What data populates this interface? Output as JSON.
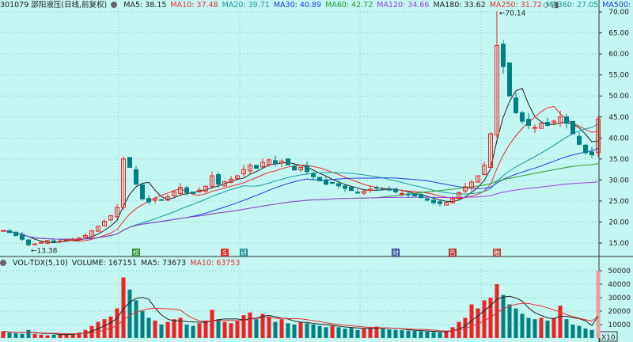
{
  "header": {
    "title": "301079 邵阳液压(日线,前复权)",
    "ma": [
      {
        "label": "MA5: 38.15",
        "color": "#222222"
      },
      {
        "label": "MA10: 37.48",
        "color": "#e53030"
      },
      {
        "label": "MA20: 39.71",
        "color": "#1a9a9a"
      },
      {
        "label": "MA30: 40.89",
        "color": "#2040e0"
      },
      {
        "label": "MA60: 42.72",
        "color": "#2a9a2a"
      },
      {
        "label": "MA120: 34.66",
        "color": "#9a40e0"
      },
      {
        "label": "MA180: 33.62",
        "color": "#222222"
      },
      {
        "label": "MA250: 31.72",
        "color": "#e53030"
      },
      {
        "label": "MA360: 27.05",
        "color": "#1a9a9a"
      },
      {
        "label": "MA500: -",
        "color": "#2040e0"
      }
    ]
  },
  "volume_header": {
    "title": "VOL-TDX(5,10)",
    "volume": "VOLUME: 167151",
    "ma5": "MA5: 73673",
    "ma10": "MA10: 63753"
  },
  "colors": {
    "up": "#ee2222",
    "down": "#008080",
    "bg": "#c4f6f2"
  },
  "chart_data": [
    {
      "type": "candlestick",
      "title": "301079 邵阳液压(日线,前复权)",
      "ylim": [
        13,
        71
      ],
      "yticks": [
        "70.00",
        "65.00",
        "60.00",
        "55.00",
        "50.00",
        "45.00",
        "40.00",
        "35.00",
        "30.00",
        "25.00",
        "20.00",
        "15.00"
      ],
      "grid": true,
      "close": [
        18.0,
        17.5,
        16.8,
        15.9,
        14.6,
        14.8,
        15.2,
        15.6,
        15.3,
        15.5,
        15.8,
        15.9,
        16.2,
        16.8,
        17.9,
        19.0,
        20.2,
        21.5,
        23.5,
        35.0,
        33.0,
        29.0,
        25.5,
        24.8,
        25.6,
        25.2,
        26.0,
        27.2,
        28.3,
        27.0,
        26.8,
        27.6,
        28.5,
        31.0,
        29.0,
        29.6,
        30.2,
        31.0,
        32.5,
        33.5,
        32.8,
        34.2,
        34.8,
        33.9,
        34.5,
        33.6,
        32.4,
        33.0,
        32.0,
        30.8,
        29.8,
        29.0,
        29.4,
        28.6,
        28.0,
        27.5,
        27.0,
        27.4,
        27.8,
        28.2,
        27.9,
        27.6,
        27.2,
        26.8,
        26.5,
        26.2,
        25.8,
        25.2,
        24.6,
        24.4,
        24.7,
        25.5,
        27.0,
        28.4,
        29.5,
        31.0,
        33.5,
        41.0,
        62.0,
        57.0,
        50.0,
        46.0,
        44.0,
        43.0,
        42.5,
        43.5,
        43.0,
        44.0,
        45.0,
        43.5,
        41.0,
        38.5,
        36.5,
        36.0,
        44.5
      ],
      "annotations": [
        {
          "text": "70.14",
          "index": 78,
          "value": 70.14
        },
        {
          "text": "13.38",
          "index": 4,
          "value": 13.38
        }
      ],
      "event_markers": [
        {
          "text": "权",
          "index": 21
        },
        {
          "text": "S",
          "index": 35
        },
        {
          "text": "研",
          "index": 38
        },
        {
          "text": "财",
          "index": 62
        },
        {
          "text": "告",
          "index": 71
        },
        {
          "text": "融",
          "index": 78
        }
      ],
      "ma_periods": [
        5,
        10,
        20,
        30,
        60,
        120
      ]
    },
    {
      "type": "bar",
      "title": "VOL-TDX(5,10)",
      "unit": "X10",
      "ylim": [
        0,
        52000
      ],
      "yticks": [
        "50000",
        "40000",
        "30000",
        "20000",
        "10000"
      ],
      "values": [
        5000,
        4000,
        3500,
        3000,
        6000,
        3000,
        2500,
        2000,
        2500,
        3000,
        2800,
        3500,
        4000,
        6000,
        9000,
        12000,
        14000,
        16000,
        22000,
        45000,
        36000,
        28000,
        20000,
        15000,
        13000,
        10000,
        12000,
        14000,
        15000,
        10000,
        9000,
        11000,
        13000,
        21000,
        14000,
        12000,
        11000,
        13000,
        17000,
        19000,
        14000,
        18000,
        16000,
        12000,
        14000,
        11000,
        10000,
        12000,
        11000,
        10000,
        9000,
        8000,
        9000,
        8000,
        7000,
        7500,
        6000,
        7000,
        8000,
        8500,
        7000,
        6500,
        6000,
        5800,
        5500,
        5200,
        5000,
        4800,
        4500,
        4200,
        5000,
        8000,
        12000,
        15000,
        25000,
        22000,
        28000,
        30000,
        40000,
        32000,
        25000,
        22000,
        18000,
        15000,
        14000,
        15000,
        13000,
        15000,
        24000,
        14000,
        10000,
        9000,
        7000,
        6000,
        50000
      ]
    }
  ]
}
